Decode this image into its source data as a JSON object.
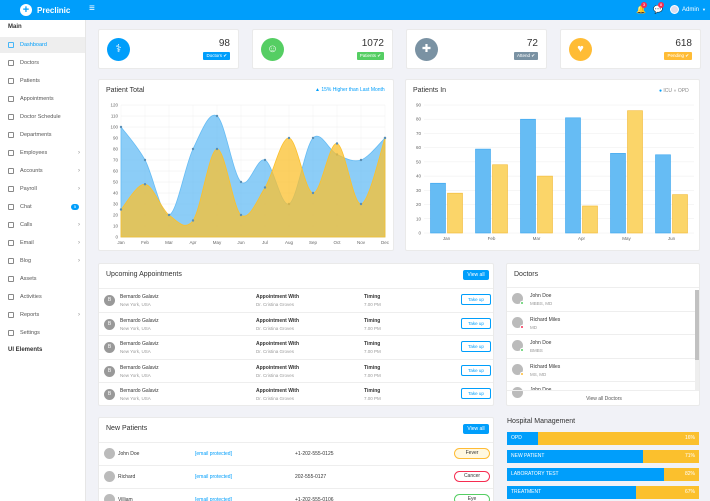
{
  "topbar": {
    "brand": "Preclinic",
    "notif_count": "3",
    "msg_count": "8",
    "user": "Admin"
  },
  "sidebar": {
    "main_title": "Main",
    "items": [
      {
        "label": "Dashboard",
        "icon": "dashboard-icon",
        "active": true
      },
      {
        "label": "Doctors",
        "icon": "doctor-icon"
      },
      {
        "label": "Patients",
        "icon": "patients-icon"
      },
      {
        "label": "Appointments",
        "icon": "calendar-icon"
      },
      {
        "label": "Doctor Schedule",
        "icon": "schedule-icon"
      },
      {
        "label": "Departments",
        "icon": "department-icon"
      },
      {
        "label": "Employees",
        "icon": "employees-icon",
        "chevron": true
      },
      {
        "label": "Accounts",
        "icon": "accounts-icon",
        "chevron": true
      },
      {
        "label": "Payroll",
        "icon": "payroll-icon",
        "chevron": true
      },
      {
        "label": "Chat",
        "icon": "chat-icon",
        "count": "5"
      },
      {
        "label": "Calls",
        "icon": "calls-icon",
        "chevron": true
      },
      {
        "label": "Email",
        "icon": "email-icon",
        "chevron": true
      },
      {
        "label": "Blog",
        "icon": "blog-icon",
        "chevron": true
      },
      {
        "label": "Assets",
        "icon": "assets-icon"
      },
      {
        "label": "Activities",
        "icon": "activities-icon"
      },
      {
        "label": "Reports",
        "icon": "reports-icon",
        "chevron": true
      },
      {
        "label": "Settings",
        "icon": "settings-icon"
      }
    ],
    "ui_title": "UI Elements"
  },
  "stats": [
    {
      "value": "98",
      "label": "Doctors",
      "color": "#009efb",
      "icon": "stethoscope-icon"
    },
    {
      "value": "1072",
      "label": "Patients",
      "color": "#55ce63",
      "icon": "user-icon"
    },
    {
      "value": "72",
      "label": "Attend",
      "color": "#7a92a3",
      "icon": "user-md-icon"
    },
    {
      "value": "618",
      "label": "Pending",
      "color": "#ffbc35",
      "icon": "heartbeat-icon"
    }
  ],
  "patient_total": {
    "title": "Patient Total",
    "trend": "15% Higher than Last Month"
  },
  "patients_in": {
    "title": "Patients In",
    "legend": [
      "ICU",
      "OPD"
    ]
  },
  "chart_data": [
    {
      "type": "area",
      "title": "Patient Total",
      "x": [
        "Jan",
        "Feb",
        "Mar",
        "Apr",
        "May",
        "Jun",
        "Jul",
        "Aug",
        "Sep",
        "Oct",
        "Nov",
        "Dec"
      ],
      "ylim": [
        0,
        120
      ],
      "yticks": [
        0,
        10,
        20,
        30,
        40,
        50,
        60,
        70,
        80,
        90,
        100,
        110,
        120
      ],
      "series": [
        {
          "values": [
            100,
            70,
            20,
            80,
            110,
            50,
            70,
            30,
            90,
            75,
            70,
            90
          ],
          "color": "#66bcf4"
        },
        {
          "values": [
            25,
            48,
            20,
            15,
            80,
            20,
            45,
            90,
            40,
            85,
            30,
            90
          ],
          "color": "#fbc02d"
        }
      ]
    },
    {
      "type": "bar",
      "title": "Patients In",
      "categories": [
        "Jan",
        "Feb",
        "Mar",
        "Apr",
        "May",
        "Jun"
      ],
      "ylim": [
        0,
        90
      ],
      "yticks": [
        0,
        10,
        20,
        30,
        40,
        50,
        60,
        70,
        80,
        90
      ],
      "series": [
        {
          "name": "ICU",
          "values": [
            35,
            59,
            80,
            81,
            56,
            55
          ],
          "color": "#66bcf4"
        },
        {
          "name": "OPD",
          "values": [
            28,
            48,
            40,
            19,
            86,
            27
          ],
          "color": "#fbd569"
        }
      ]
    }
  ],
  "appointments": {
    "title": "Upcoming Appointments",
    "view_all": "View all",
    "rows": [
      {
        "initial": "B",
        "name": "Bernardo Galaviz",
        "loc": "New York, USA",
        "with": "Appointment With",
        "doctor": "Dr. Cristina Groves",
        "timing": "Timing",
        "time": "7.00 PM",
        "action": "Take up"
      },
      {
        "initial": "B",
        "name": "Bernardo Galaviz",
        "loc": "New York, USA",
        "with": "Appointment With",
        "doctor": "Dr. Cristina Groves",
        "timing": "Timing",
        "time": "7.00 PM",
        "action": "Take up"
      },
      {
        "initial": "B",
        "name": "Bernardo Galaviz",
        "loc": "New York, USA",
        "with": "Appointment With",
        "doctor": "Dr. Cristina Groves",
        "timing": "Timing",
        "time": "7.00 PM",
        "action": "Take up"
      },
      {
        "initial": "B",
        "name": "Bernardo Galaviz",
        "loc": "New York, USA",
        "with": "Appointment With",
        "doctor": "Dr. Cristina Groves",
        "timing": "Timing",
        "time": "7.00 PM",
        "action": "Take up"
      },
      {
        "initial": "B",
        "name": "Bernardo Galaviz",
        "loc": "New York, USA",
        "with": "Appointment With",
        "doctor": "Dr. Cristina Groves",
        "timing": "Timing",
        "time": "7.00 PM",
        "action": "Take up"
      }
    ]
  },
  "doctors": {
    "title": "Doctors",
    "view_all": "View all Doctors",
    "items": [
      {
        "name": "John Doe",
        "deg": "MBBS, MD",
        "status": "#55ce63"
      },
      {
        "name": "Richard Miles",
        "deg": "MD",
        "status": "#f62d51"
      },
      {
        "name": "John Doe",
        "deg": "BMBS",
        "status": "#55ce63"
      },
      {
        "name": "Richard Miles",
        "deg": "MS, MD",
        "status": "#ffbc35"
      },
      {
        "name": "John Doe",
        "deg": ""
      }
    ]
  },
  "new_patients": {
    "title": "New Patients",
    "view_all": "View all",
    "rows": [
      {
        "name": "John Doe",
        "email": "[email protected]",
        "phone": "+1-202-555-0125",
        "status": "Fever",
        "bg": "#fff8e1",
        "fg": "#333",
        "bd": "#ffbc35"
      },
      {
        "name": "Richard",
        "email": "[email protected]",
        "phone": "202-555-0127",
        "status": "Cancer",
        "bg": "#fff",
        "fg": "#333",
        "bd": "#f62d51"
      },
      {
        "name": "Villiam",
        "email": "[email protected]",
        "phone": "+1-202-555-0106",
        "status": "Eye",
        "bg": "#fff",
        "fg": "#333",
        "bd": "#55ce63"
      }
    ]
  },
  "hospital": {
    "title": "Hospital Management",
    "bars": [
      {
        "label": "OPD",
        "value": 16
      },
      {
        "label": "NEW PATIENT",
        "value": 71
      },
      {
        "label": "LABORATORY TEST",
        "value": 82
      },
      {
        "label": "TREATMENT",
        "value": 67
      }
    ]
  }
}
